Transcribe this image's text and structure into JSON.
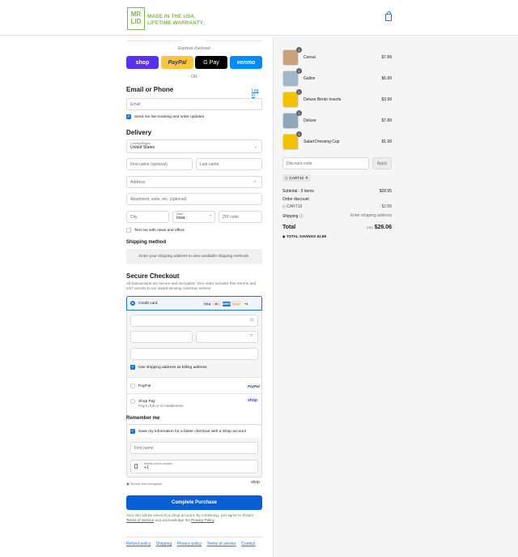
{
  "brand": {
    "logo_text": "MR LID",
    "tagline_1": "MADE IN THE USA.",
    "tagline_2": "LIFETIME WARRANTY."
  },
  "express": {
    "title": "Express checkout",
    "buttons": [
      {
        "label": "shop",
        "color": "#5a31f4"
      },
      {
        "label": "PayPal",
        "color": "#ffc439"
      },
      {
        "label": "G Pay",
        "color": "#000000"
      },
      {
        "label": "venmo",
        "color": "#008cff"
      }
    ],
    "or_label": "OR"
  },
  "contact": {
    "title": "Email or Phone",
    "login_link": "Log in",
    "email_placeholder": "Email",
    "tracking_label": "Send me live tracking and order updates"
  },
  "delivery": {
    "title": "Delivery",
    "country_label": "Country/Region",
    "country_value": "United States",
    "first_name": "First name (optional)",
    "last_name": "Last name",
    "address": "Address",
    "apartment": "Apartment, suite, etc. (optional)",
    "city": "City",
    "state_label": "State",
    "state_value": "Iowa",
    "zip": "ZIP code",
    "news_label": "Text me with news and offers"
  },
  "shipping": {
    "title": "Shipping method",
    "message": "Enter your shipping address to view available shipping methods."
  },
  "payment": {
    "title": "Secure Checkout",
    "subtitle": "All transactions are secure and encrypted. Your order includes free returns and 24/7 access to our award-winning customer service",
    "credit_card_label": "Credit card",
    "card_badges": [
      "VISA",
      "MC",
      "AMEX",
      "DISC",
      "+4"
    ],
    "billing_label": "Use shipping address as billing address",
    "paypal_label": "PayPal",
    "paypal_logo": "PayPal",
    "shoppay_label": "Shop Pay",
    "shoppay_sub": "Pay in full or in installments",
    "shoppay_logo": "shop"
  },
  "remember": {
    "title": "Remember me",
    "save_label": "Save my information for a faster checkout with a Shop account",
    "first_name": "First name",
    "phone_label": "Mobile phone number",
    "phone_value": "+1",
    "secure_label": "Secure and encrypted",
    "shop_logo": "shop"
  },
  "complete_button": "Complete Purchase",
  "disclaimer_1": "Your info will be saved to a Shop account. By continuing, you agree to Shop's",
  "disclaimer_terms": "Terms of Service",
  "disclaimer_2": " and acknowledge the ",
  "disclaimer_privacy": "Privacy Policy",
  "footer_links": [
    "Refund policy",
    "Shipping",
    "Privacy policy",
    "Terms of service",
    "Contact"
  ],
  "cart": {
    "items": [
      {
        "name": "Cereal",
        "price": "$7.89",
        "qty": "1",
        "color": "#c9a27b"
      },
      {
        "name": "Gallon",
        "price": "$6.99",
        "qty": "1",
        "color": "#9fb7c9"
      },
      {
        "name": "Deluxe Bento Inserts",
        "price": "$3.99",
        "qty": "1",
        "color": "#f2c200"
      },
      {
        "name": "Deluxe",
        "price": "$7.89",
        "qty": "1",
        "color": "#8fa7b8"
      },
      {
        "name": "Salad Dressing Cup",
        "price": "$1.99",
        "qty": "1",
        "color": "#f2c200"
      }
    ],
    "discount_placeholder": "Discount code",
    "apply_label": "Apply",
    "discount_tag": "CART10",
    "subtotal_label": "Subtotal · 5 items",
    "subtotal_value": "$28.95",
    "order_discount_label": "Order discount",
    "discount_code": "CART10",
    "discount_value": "- $2.89",
    "shipping_label": "Shipping",
    "shipping_value": "Enter shipping address",
    "total_label": "Total",
    "currency": "USD",
    "total_value": "$26.06",
    "savings_label": "TOTAL SAVINGS",
    "savings_value": "$2.89"
  }
}
